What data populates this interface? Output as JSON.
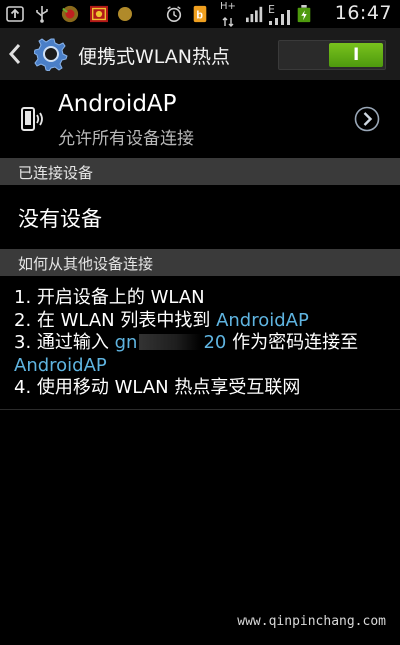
{
  "status_bar": {
    "time": "16:47",
    "network_type": "E",
    "data_indicator": "H+",
    "icons": [
      "upload-icon",
      "usb-icon",
      "app-icon",
      "app-icon",
      "app-icon",
      "alarm-icon",
      "notification-icon",
      "sim-icon",
      "signal-icon",
      "battery-icon"
    ]
  },
  "action_bar": {
    "title": "便携式WLAN热点",
    "toggle_label": "I",
    "toggle_on": true,
    "accent": "#5fa814"
  },
  "network": {
    "name": "AndroidAP",
    "subtitle": "允许所有设备连接"
  },
  "connected_section": {
    "header": "已连接设备",
    "empty_text": "没有设备"
  },
  "howto_section": {
    "header": "如何从其他设备连接",
    "steps": {
      "s1": "1. 开启设备上的 WLAN",
      "s2_pre": "2. 在 WLAN 列表中找到 ",
      "s2_ap": "AndroidAP",
      "s3_pre": "3. 通过输入 ",
      "s3_pw_visible_start": "gn",
      "s3_pw_visible_end": "20",
      "s3_post": " 作为密码连接至",
      "s3_ap": "AndroidAP",
      "s4": "4. 使用移动 WLAN 热点享受互联网"
    }
  },
  "watermark": "www.qinpinchang.com"
}
